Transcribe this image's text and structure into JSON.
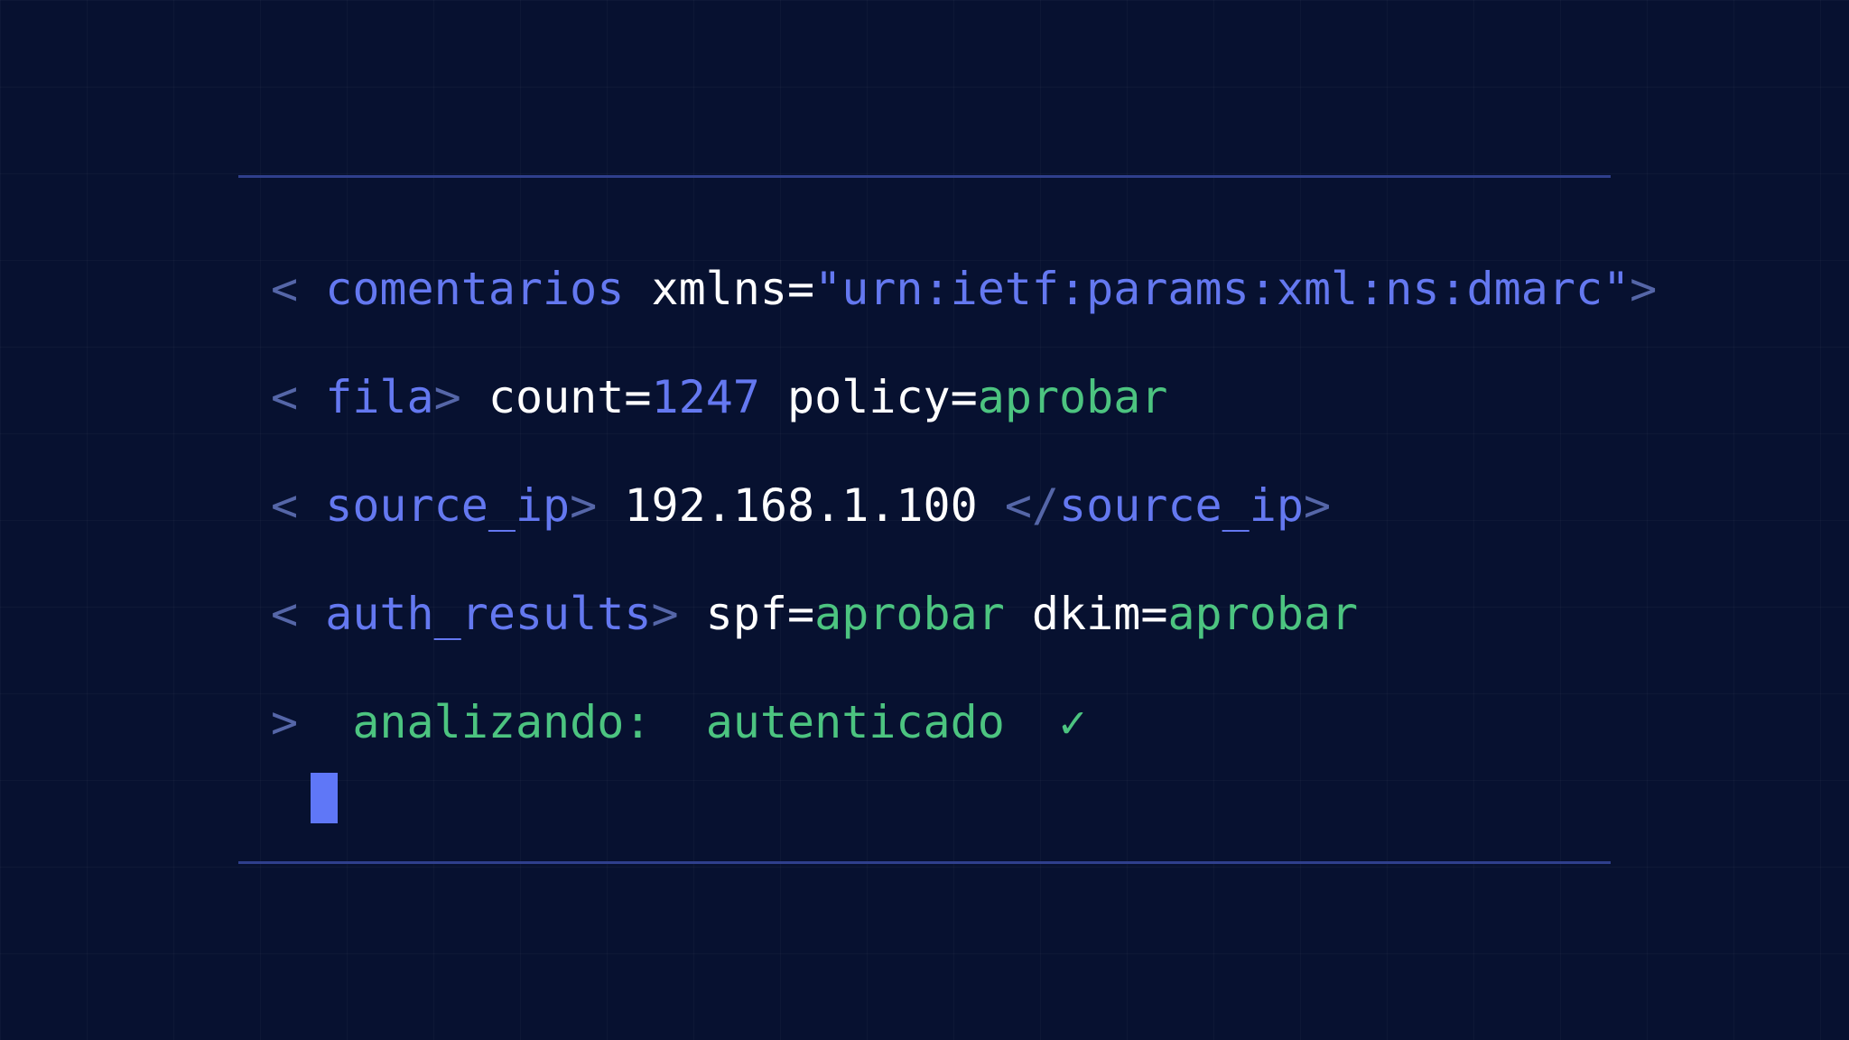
{
  "terminal": {
    "line1": {
      "open": "<",
      "tag": "comentarios",
      "attr_name": "xmlns=",
      "attr_value": "\"urn:ietf:params:xml:ns:dmarc\"",
      "close": ">"
    },
    "line2": {
      "open": "<",
      "tag": "fila",
      "close": ">",
      "count_label": "count=",
      "count_value": "1247",
      "policy_label": "policy=",
      "policy_value": "aprobar"
    },
    "line3": {
      "open": "<",
      "tag": "source_ip",
      "close": ">",
      "ip_value": "192.168.1.100",
      "end_open": "</",
      "end_tag": "source_ip",
      "end_close": ">"
    },
    "line4": {
      "open": "<",
      "tag": "auth_results",
      "close": ">",
      "spf_label": "spf=",
      "spf_value": "aprobar",
      "dkim_label": "dkim=",
      "dkim_value": "aprobar"
    },
    "line5": {
      "prompt": ">",
      "status_label": "analizando:",
      "status_value": "autenticado",
      "check": "✓"
    }
  },
  "colors": {
    "background": "#071130",
    "rule": "#2f3f8c",
    "punctuation": "#5566a8",
    "tag": "#6478f0",
    "text": "#ffffff",
    "success": "#4cc480",
    "cursor": "#5f77f7"
  }
}
